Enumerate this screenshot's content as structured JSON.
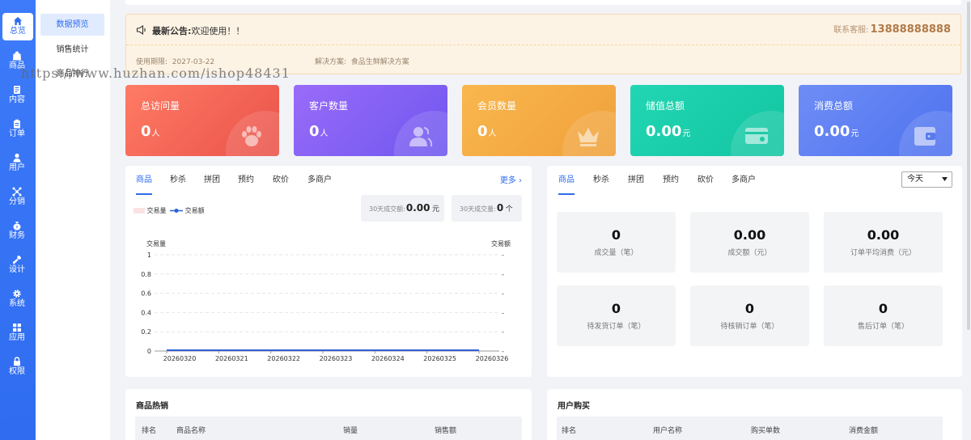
{
  "nav": {
    "items": [
      {
        "label": "总览",
        "icon": "home-icon"
      },
      {
        "label": "商品",
        "icon": "bag-icon"
      },
      {
        "label": "内容",
        "icon": "document-icon"
      },
      {
        "label": "订单",
        "icon": "clipboard-icon"
      },
      {
        "label": "用户",
        "icon": "user-icon"
      },
      {
        "label": "分销",
        "icon": "share-icon"
      },
      {
        "label": "财务",
        "icon": "money-bag-icon"
      },
      {
        "label": "设计",
        "icon": "brush-icon"
      },
      {
        "label": "系统",
        "icon": "gear-icon"
      },
      {
        "label": "应用",
        "icon": "grid-icon"
      },
      {
        "label": "权限",
        "icon": "lock-icon"
      }
    ],
    "active_index": 0
  },
  "subnav": {
    "items": [
      "数据预览",
      "销售统计",
      "商品排行"
    ],
    "active_index": 0
  },
  "watermark": "https://www.huzhan.com/ishop48431",
  "notice": {
    "title": "最新公告:",
    "message": "欢迎使用！！",
    "contact_label": "联系客服:",
    "contact_phone": "13888888888",
    "expiry_label": "使用期限:",
    "expiry_date": "2027-03-22",
    "solution_label": "解决方案:",
    "solution_value": "食品生鲜解决方案"
  },
  "stats": [
    {
      "label": "总访问量",
      "value": "0",
      "unit": "人",
      "icon": "paw-icon",
      "color_from": "#ff7b64",
      "color_to": "#e9524a"
    },
    {
      "label": "客户数量",
      "value": "0",
      "unit": "人",
      "icon": "users-icon",
      "color_from": "#9a6bf9",
      "color_to": "#6e57ef"
    },
    {
      "label": "会员数量",
      "value": "0",
      "unit": "人",
      "icon": "crown-icon",
      "color_from": "#f9b74e",
      "color_to": "#f0a03a"
    },
    {
      "label": "储值总额",
      "value": "0.00",
      "unit": "元",
      "icon": "card-icon",
      "color_from": "#22d6b3",
      "color_to": "#13c5a2"
    },
    {
      "label": "消费总额",
      "value": "0.00",
      "unit": "元",
      "icon": "wallet-icon",
      "color_from": "#6e8df5",
      "color_to": "#4e72ef"
    }
  ],
  "left_panel": {
    "tabs": [
      "商品",
      "秒杀",
      "拼团",
      "预约",
      "砍价",
      "多商户"
    ],
    "active_tab": 0,
    "more": "更多",
    "legend_volume": "交易量",
    "legend_amount": "交易额",
    "summary_amount_label": "30天成交额:",
    "summary_amount_value": "0.00",
    "summary_amount_unit": "元",
    "summary_count_label": "30天成交量:",
    "summary_count_value": "0",
    "summary_count_unit": "个"
  },
  "chart_data": {
    "type": "line",
    "x": [
      "20260320",
      "20260321",
      "20260322",
      "20260323",
      "20260324",
      "20260325",
      "20260326"
    ],
    "series": [
      {
        "name": "交易量",
        "values": [
          0,
          0,
          0,
          0,
          0,
          0,
          0
        ],
        "color": "#fbe3e3"
      },
      {
        "name": "交易额",
        "values": [
          0,
          0,
          0,
          0,
          0,
          0,
          0
        ],
        "color": "#2f5fd9"
      }
    ],
    "ylabel_left": "交易量",
    "ylabel_right": "交易额",
    "yticks_left": [
      "0",
      "0.2",
      "0.4",
      "0.6",
      "0.8",
      "1"
    ],
    "yticks_right": [
      "-",
      "-",
      "-",
      "-",
      "-",
      "-"
    ],
    "ylim": [
      0,
      1
    ],
    "grid": true
  },
  "right_panel": {
    "tabs": [
      "商品",
      "秒杀",
      "拼团",
      "预约",
      "砍价",
      "多商户"
    ],
    "active_tab": 0,
    "period": "今天",
    "metrics": [
      {
        "value": "0",
        "label": "成交量（笔）"
      },
      {
        "value": "0.00",
        "label": "成交额（元）"
      },
      {
        "value": "0.00",
        "label": "订单平均消费（元）"
      },
      {
        "value": "0",
        "label": "待发货订单（笔）"
      },
      {
        "value": "0",
        "label": "待核销订单（笔）"
      },
      {
        "value": "0",
        "label": "售后订单（笔）"
      }
    ]
  },
  "hot_products": {
    "title": "商品热销",
    "columns": [
      "排名",
      "商品名称",
      "销量",
      "销售额"
    ]
  },
  "user_purchases": {
    "title": "用户购买",
    "columns": [
      "排名",
      "用户名称",
      "购买单数",
      "消费金额"
    ]
  }
}
